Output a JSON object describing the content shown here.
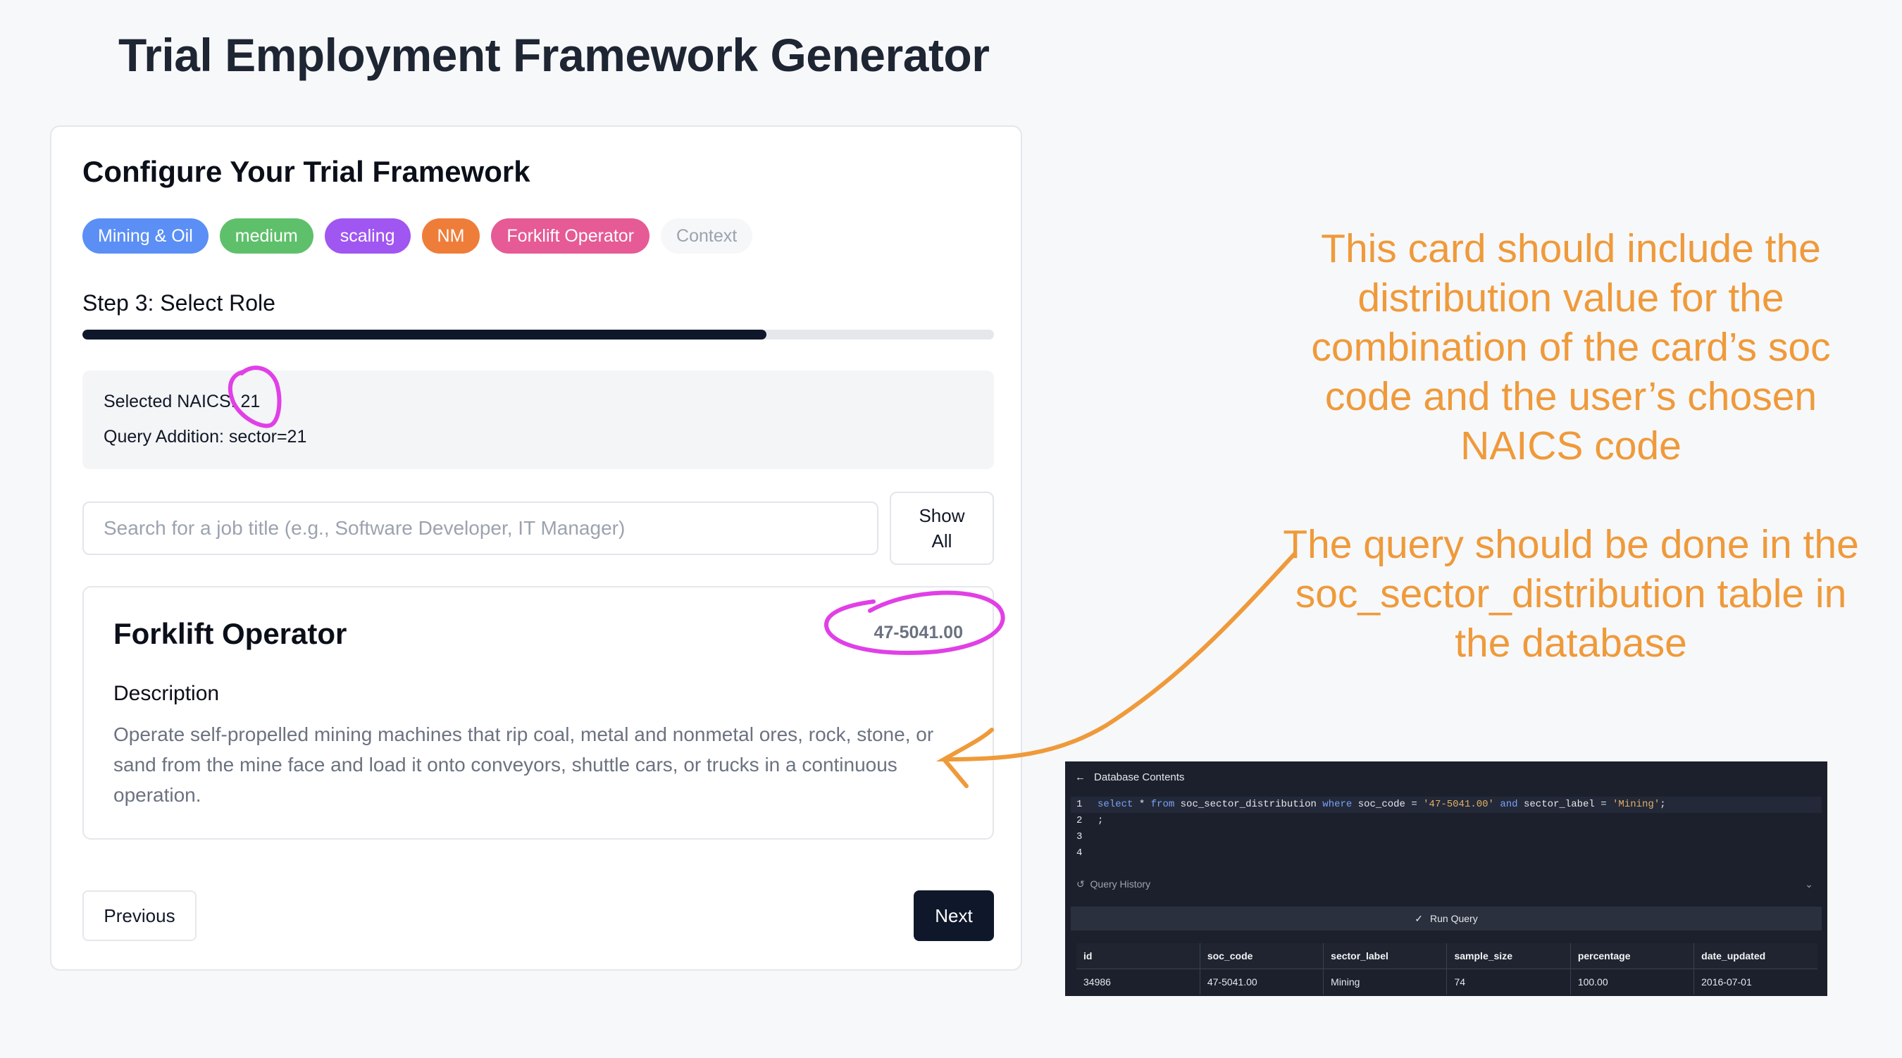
{
  "page": {
    "title": "Trial Employment Framework Generator"
  },
  "card": {
    "title": "Configure Your Trial Framework",
    "tags": [
      {
        "label": "Mining & Oil",
        "color": "#5b8ff5"
      },
      {
        "label": "medium",
        "color": "#5ec06a"
      },
      {
        "label": "scaling",
        "color": "#a056f0"
      },
      {
        "label": "NM",
        "color": "#ef7d3a"
      },
      {
        "label": "Forklift Operator",
        "color": "#e65a95"
      },
      {
        "label": "Context",
        "color": "#f6f7f9"
      }
    ],
    "step_label": "Step 3: Select Role",
    "progress_fraction": 0.75,
    "naics_line": "Selected NAICS: 21",
    "query_line": "Query Addition: sector=21",
    "search_placeholder": "Search for a job title (e.g., Software Developer, IT Manager)",
    "show_all_label": "Show All",
    "job": {
      "title": "Forklift Operator",
      "soc_code": "47-5041.00",
      "description_label": "Description",
      "description": "Operate self-propelled mining machines that rip coal, metal and nonmetal ores, rock, stone, or sand from the mine face and load it onto conveyors, shuttle cars, or trucks in a continuous operation."
    },
    "previous_label": "Previous",
    "next_label": "Next"
  },
  "annotations": {
    "note1": "This card should include the distribution value for the combination of the card’s soc code and the user’s chosen NAICS code",
    "note2": "The query should be done in the soc_sector_distribution table in the database",
    "highlight_color": "#e040e6",
    "arrow_color": "#ef9a3a"
  },
  "db": {
    "header": "Database Contents",
    "line_numbers": [
      "1",
      "2",
      "3",
      "4"
    ],
    "sql": {
      "select": "select",
      "star": " * ",
      "from": "from",
      "table": " soc_sector_distribution ",
      "where": "where",
      "cond1": " soc_code = ",
      "val1": "'47-5041.00'",
      "and": "and",
      "cond2": " sector_label = ",
      "val2": "'Mining'",
      "end": ";",
      "line2": ";"
    },
    "query_history_label": "Query History",
    "run_query_label": "Run Query",
    "columns": [
      "id",
      "soc_code",
      "sector_label",
      "sample_size",
      "percentage",
      "date_updated"
    ],
    "rows": [
      [
        "34986",
        "47-5041.00",
        "Mining",
        "74",
        "100.00",
        "2016-07-01"
      ]
    ]
  }
}
